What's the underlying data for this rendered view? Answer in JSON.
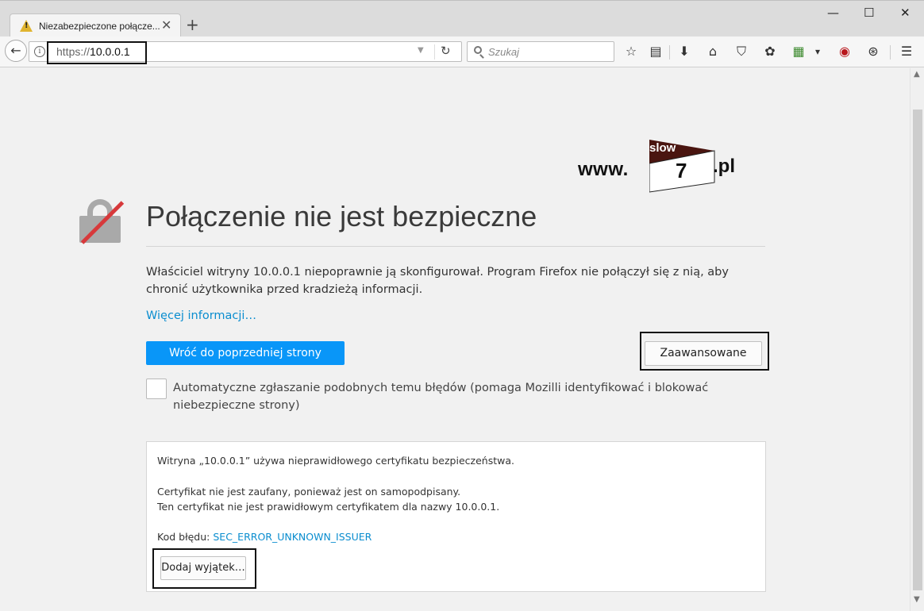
{
  "tab": {
    "title": "Niezabezpieczone połącze...",
    "close_glyph": "✕",
    "new_tab_glyph": "+"
  },
  "window_controls": {
    "minimize": "—",
    "maximize": "☐",
    "close": "✕"
  },
  "navbar": {
    "back_glyph": "←",
    "info_glyph": "i",
    "url_protocol": "https://",
    "url_host": "10.0.0.1",
    "dropdown_glyph": "▼",
    "reload_glyph": "↻",
    "search_placeholder": "Szukaj",
    "icons": [
      "bookmark-star-icon",
      "reading-list-icon",
      "download-icon",
      "home-icon",
      "pocket-icon",
      "extension-icon",
      "extension-icon-2",
      "dropdown-icon",
      "ublock-icon",
      "addon-icon",
      "menu-icon"
    ],
    "icon_glyphs": {
      "star": "☆",
      "reading_list": "▤",
      "download": "⬇",
      "home": "⌂",
      "pocket": "⛉",
      "ext1": "✿",
      "ext2": "▦",
      "dropdown": "▾",
      "ublock": "◉",
      "addon": "⊛",
      "menu": "☰"
    }
  },
  "logo": {
    "www": "www.",
    "slow": "slow",
    "seven": "7",
    "pl": ".pl",
    "colors": {
      "flag": "#4a1510",
      "text": "#111111"
    }
  },
  "error_page": {
    "title": "Połączenie nie jest bezpieczne",
    "description": "Właściciel witryny 10.0.0.1 niepoprawnie ją skonfigurował. Program Firefox nie połączył się z nią, aby chronić użytkownika przed kradzieżą informacji.",
    "more_info": "Więcej informacji…",
    "back_button": "Wróć do poprzedniej strony",
    "advanced_button": "Zaawansowane",
    "report_checkbox_label": "Automatyczne zgłaszanie podobnych temu błędów (pomaga Mozilli identyfikować i blokować niebezpieczne strony)",
    "report_checked": false,
    "details": {
      "line1": "Witryna „10.0.0.1” używa nieprawidłowego certyfikatu bezpieczeństwa.",
      "line2": "Certyfikat nie jest zaufany, ponieważ jest on samopodpisany.",
      "line3": "Ten certyfikat nie jest prawidłowym certyfikatem dla nazwy 10.0.0.1.",
      "error_code_label": "Kod błędu: ",
      "error_code": "SEC_ERROR_UNKNOWN_ISSUER",
      "add_exception_button": "Dodaj wyjątek…"
    }
  },
  "scrollbar": {
    "up_glyph": "▲",
    "down_glyph": "▼"
  },
  "colors": {
    "primary_button": "#0996f8",
    "link": "#0a8dcf",
    "lock_slash": "#d7393b",
    "lock_gray": "#a9a9a9",
    "warning": "#e0b42f"
  }
}
